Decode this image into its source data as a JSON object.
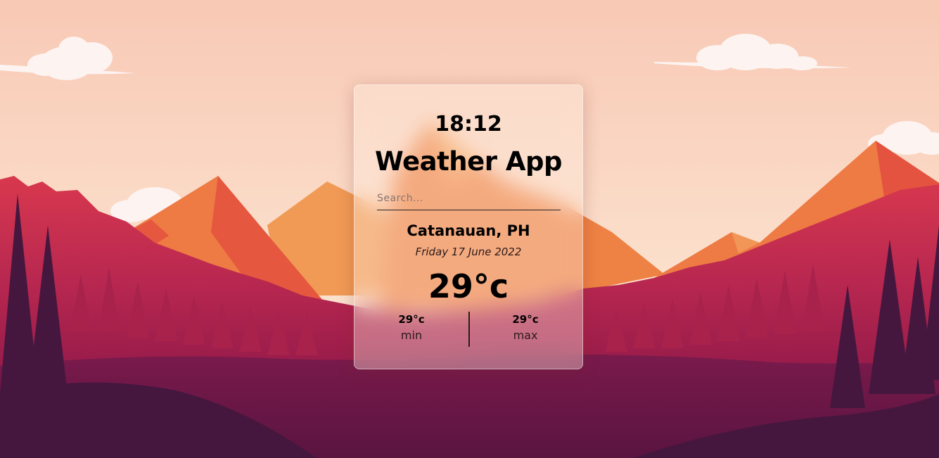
{
  "colors": {
    "sky_top": "#f8c9b5",
    "sky_bottom": "#fbe3d0",
    "mountain_orange": "#ef7a3e",
    "mountain_red": "#e5533f",
    "forest_crimson": "#c8304f",
    "forest_deep": "#8e1848",
    "ground_dark": "#5e1542",
    "tree_dark": "#45173f"
  },
  "weather": {
    "time": "18:12",
    "title": "Weather App",
    "search_placeholder": "Search...",
    "location": "Catanauan, PH",
    "date": "Friday 17 June 2022",
    "temperature": "29°c",
    "min_value": "29°c",
    "min_label": "min",
    "max_value": "29°c",
    "max_label": "max"
  }
}
